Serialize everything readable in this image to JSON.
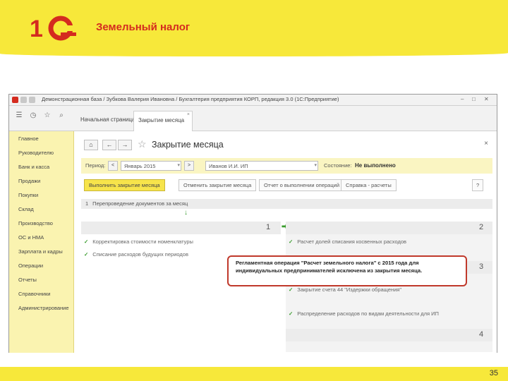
{
  "slide": {
    "title": "Земельный налог",
    "page_number": "35",
    "logo_text": "1С"
  },
  "window": {
    "title": "Демонстрационная база / Зубкова Валерия Ивановна / Бухгалтерия предприятия КОРП, редакция 3.0 (1С:Предприятие)",
    "tabs": [
      {
        "label": "Начальная страница"
      },
      {
        "label": "Закрытие месяца"
      }
    ]
  },
  "sidebar": {
    "items": [
      {
        "label": "Главное"
      },
      {
        "label": "Руководителю"
      },
      {
        "label": "Банк и касса"
      },
      {
        "label": "Продажи"
      },
      {
        "label": "Покупки"
      },
      {
        "label": "Склад"
      },
      {
        "label": "Производство"
      },
      {
        "label": "ОС и НМА"
      },
      {
        "label": "Зарплата и кадры"
      },
      {
        "label": "Операции"
      },
      {
        "label": "Отчеты"
      },
      {
        "label": "Справочники"
      },
      {
        "label": "Администрирование"
      }
    ]
  },
  "form": {
    "title": "Закрытие месяца",
    "period_label": "Период:",
    "period_value": "Январь 2015",
    "org_value": "Иванов И.И. ИП",
    "status_label": "Состояние:",
    "status_value": "Не выполнено",
    "buttons": {
      "run": "Выполнить закрытие месяца",
      "cancel": "Отменить закрытие месяца",
      "report": "Отчет о выполнении операций",
      "help": "Справка - расчеты",
      "question": "?"
    },
    "section1": "Перепроведение документов за месяц",
    "col_left_num": "1",
    "col_right_num_2": "2",
    "col_right_num_3": "3",
    "col_right_num_4": "4",
    "left_ops": [
      "Корректировка стоимости номенклатуры",
      "Списание расходов будущих периодов"
    ],
    "right_ops": [
      "Расчет долей списания косвенных расходов",
      "Закрытие счета 44 \"Издержки обращения\"",
      "Распределение расходов по видам деятельности для ИП"
    ]
  },
  "callout": {
    "text": "Регламентная операция \"Расчет земельного налога\" с 2015 года для индивидуальных предпринимателей исключена из закрытия месяца."
  },
  "colors": {
    "accent_yellow": "#f7e83a",
    "title_red": "#d42b1f",
    "callout_border": "#c0392b",
    "check_green": "#3a9c2e"
  }
}
